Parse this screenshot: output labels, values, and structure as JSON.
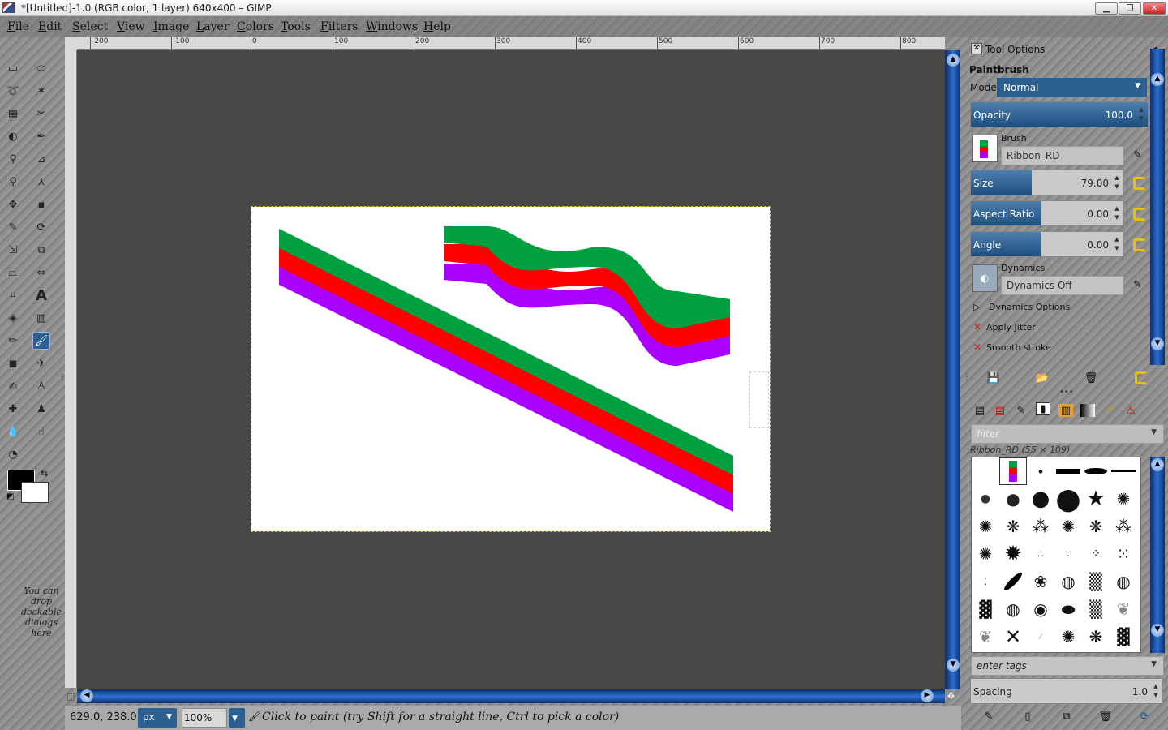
{
  "window": {
    "title": "*[Untitled]-1.0 (RGB color, 1 layer) 640x400 – GIMP"
  },
  "menu": [
    "File",
    "Edit",
    "Select",
    "View",
    "Image",
    "Layer",
    "Colors",
    "Tools",
    "Filters",
    "Windows",
    "Help"
  ],
  "ruler_ticks": [
    "-200",
    "-100",
    "0",
    "100",
    "200",
    "300",
    "400",
    "500",
    "600",
    "700",
    "800"
  ],
  "toolbox": {
    "drop_hint": "You can drop dockable dialogs here",
    "fg_color": "#000000",
    "bg_color": "#ffffff",
    "selected_tool": "paintbrush"
  },
  "canvas": {
    "width": 640,
    "height": 400,
    "stroke_colors": {
      "top": "#00a040",
      "middle": "#ff0000",
      "bottom": "#aa00ff"
    }
  },
  "status": {
    "coords": "629.0, 238.0",
    "unit": "px",
    "zoom": "100",
    "zoom_suffix": "%",
    "message": "Click to paint (try Shift for a straight line, Ctrl to pick a color)"
  },
  "tool_options": {
    "tab_title": "Tool Options",
    "tool_name": "Paintbrush",
    "mode_label": "Mode:",
    "mode_value": "Normal",
    "opacity": {
      "label": "Opacity",
      "value": "100.0"
    },
    "brush_label": "Brush",
    "brush_name": "Ribbon_RD",
    "size": {
      "label": "Size",
      "value": "79.00"
    },
    "aspect_ratio": {
      "label": "Aspect Ratio",
      "value": "0.00"
    },
    "angle": {
      "label": "Angle",
      "value": "0.00"
    },
    "dynamics_label": "Dynamics",
    "dynamics_value": "Dynamics Off",
    "dynamics_options": "Dynamics Options",
    "apply_jitter": "Apply Jitter",
    "smooth_stroke": "Smooth stroke"
  },
  "brushes": {
    "filter_placeholder": "filter",
    "current": "Ribbon_RD (55 × 109)",
    "tags_placeholder": "enter tags",
    "spacing": {
      "label": "Spacing",
      "value": "1.0"
    }
  },
  "colors": {
    "accent": "#2b5f8f",
    "scroll": "#1b4fa0"
  }
}
